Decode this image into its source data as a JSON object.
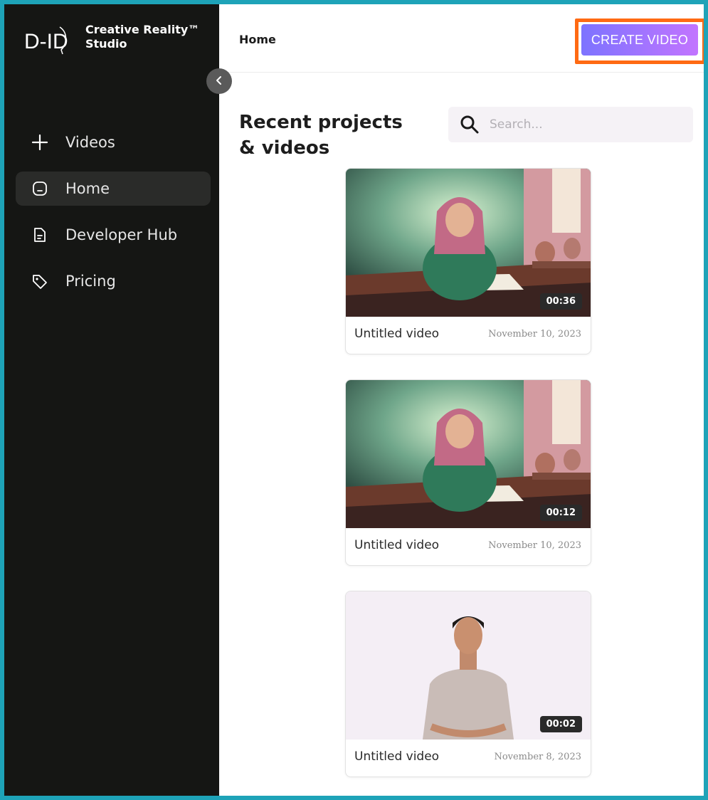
{
  "app": {
    "brand_line1": "Creative Reality™",
    "brand_line2": "Studio",
    "logo_text": "D-ID"
  },
  "sidebar": {
    "items": [
      {
        "label": "Videos",
        "icon": "plus-icon",
        "active": false
      },
      {
        "label": "Home",
        "icon": "home-icon",
        "active": true
      },
      {
        "label": "Developer Hub",
        "icon": "document-icon",
        "active": false
      },
      {
        "label": "Pricing",
        "icon": "tag-icon",
        "active": false
      }
    ]
  },
  "header": {
    "breadcrumb": "Home",
    "create_label": "CREATE VIDEO"
  },
  "main": {
    "section_title": "Recent projects & videos",
    "search_placeholder": "Search..."
  },
  "videos": [
    {
      "title": "Untitled video",
      "date": "November 10, 2023",
      "duration": "00:36"
    },
    {
      "title": "Untitled video",
      "date": "November 10, 2023",
      "duration": "00:12"
    },
    {
      "title": "Untitled video",
      "date": "November 8, 2023",
      "duration": "00:02"
    }
  ],
  "colors": {
    "sidebar_bg": "#151614",
    "accent_start": "#7d73ff",
    "accent_end": "#c274ff",
    "highlight": "#ff6a13",
    "frame": "#1ea3b8"
  }
}
